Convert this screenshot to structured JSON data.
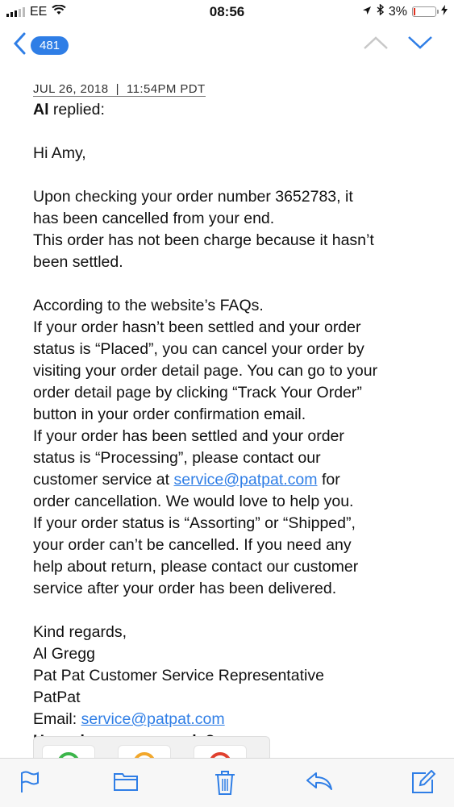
{
  "status": {
    "carrier": "EE",
    "time": "08:56",
    "battery": "3%"
  },
  "nav": {
    "back_count": "481"
  },
  "email": {
    "date": "JUL 26, 2018  |  11:54PM PDT",
    "sender": "Al",
    "replied_text": " replied:",
    "greeting": "Hi Amy,",
    "p1_line1": "Upon checking your order number 3652783, it",
    "p1_line2": "has been cancelled from your end.",
    "p1_line3": "This order has not been charge because it hasn’t",
    "p1_line4": "been settled.",
    "p2_line1": "According to the website’s FAQs.",
    "p2_line2": "If your order hasn’t been settled and your order",
    "p2_line3": "status is “Placed”, you can cancel your order by",
    "p2_line4": "visiting your order detail page. You can go to your",
    "p2_line5": "order detail page by clicking “Track Your Order”",
    "p2_line6": "button in your order confirmation email.",
    "p2_line7": "If your order has been settled and your order",
    "p2_line8": "status is “Processing”, please contact our",
    "p2_line9_pre": "customer service at ",
    "service_email": "service@patpat.com",
    "p2_line9_post": " for",
    "p2_line10": "order cancellation. We would love to help you.",
    "p2_line11": "If your order status is “Assorting” or “Shipped”,",
    "p2_line12": "your order can’t be cancelled. If you need any",
    "p2_line13": "help about return, please contact our customer",
    "p2_line14": "service after your order has been delivered.",
    "sign1": "Kind regards,",
    "sign2": "Al Gregg",
    "sign3": "Pat Pat Customer Service Representative",
    "sign4": "PatPat",
    "email_label": "Email: ",
    "question": "How nice was my reply?"
  },
  "colors": {
    "accent": "#2f7ee6",
    "good": "#3bb54a",
    "ok": "#f2a72b",
    "bad": "#e0402e"
  }
}
